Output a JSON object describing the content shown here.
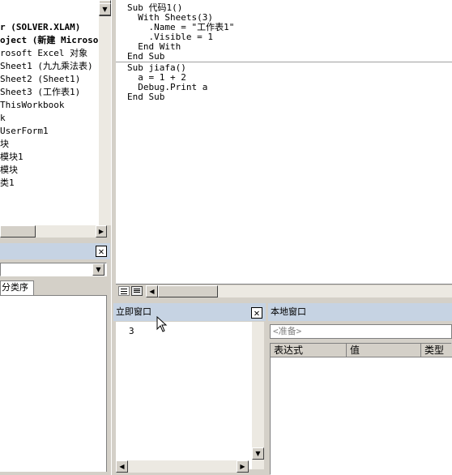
{
  "project_explorer": {
    "items": [
      {
        "label": "r (SOLVER.XLAM)",
        "bold": true
      },
      {
        "label": "oject (新建 Microsof",
        "bold": true
      },
      {
        "label": "rosoft Excel 对象",
        "bold": false
      },
      {
        "label": "Sheet1 (九九乘法表)",
        "bold": false
      },
      {
        "label": "Sheet2 (Sheet1)",
        "bold": false
      },
      {
        "label": "Sheet3 (工作表1)",
        "bold": false
      },
      {
        "label": "ThisWorkbook",
        "bold": false
      },
      {
        "label": "k",
        "bold": false
      },
      {
        "label": "UserForm1",
        "bold": false
      },
      {
        "label": "块",
        "bold": false
      },
      {
        "label": "模块1",
        "bold": false
      },
      {
        "label": "模块",
        "bold": false
      },
      {
        "label": "类1",
        "bold": false
      }
    ]
  },
  "properties_panel": {
    "tab_label": "分类序"
  },
  "code_window": {
    "proc1": [
      "Sub 代码1()",
      "  With Sheets(3)",
      "    .Name = \"工作表1\"",
      "    .Visible = 1",
      "  End With",
      "End Sub"
    ],
    "proc2": [
      "Sub jiafa()",
      "  a = 1 + 2",
      "  Debug.Print a",
      "End Sub"
    ]
  },
  "immediate_window": {
    "title": "立即窗口",
    "output": "3"
  },
  "locals_window": {
    "title": "本地窗口",
    "status": "<准备>",
    "columns": [
      "表达式",
      "值",
      "类型"
    ]
  }
}
